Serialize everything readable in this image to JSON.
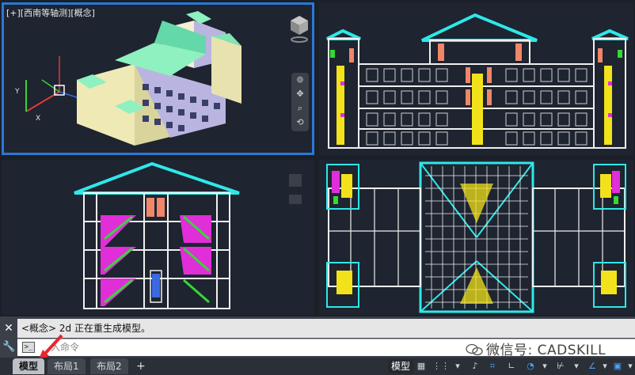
{
  "colors": {
    "viewport_bg": "#1e2430",
    "active_border": "#2a78d6",
    "roof": "#2ee8e8",
    "wall": "#f0f0f0",
    "yellow": "#f2e21b",
    "magenta": "#e02ed8",
    "green": "#35d835",
    "salmon": "#f0866a",
    "arrow_red": "#e8262b"
  },
  "viewports": {
    "top_left_label": "[+][西南等轴测][概念]"
  },
  "command": {
    "history_text": "<概念>    2d  正在重生成模型。",
    "input_placeholder": "入命令",
    "prompt_icon": "terminal-prompt-icon"
  },
  "watermark": {
    "text": "微信号: CADSKILL"
  },
  "status": {
    "tabs": [
      "模型",
      "布局1",
      "布局2"
    ],
    "active_tab": "模型",
    "add_tab": "+",
    "model_label": "模型",
    "icons": [
      "grid-icon",
      "snap-icon",
      "infer-icon",
      "dynamic-ucs-icon",
      "ortho-icon",
      "polar-icon",
      "osnap-icon",
      "lineweight-icon",
      "isodraft-icon",
      "annotation-icon",
      "customize-icon"
    ]
  }
}
